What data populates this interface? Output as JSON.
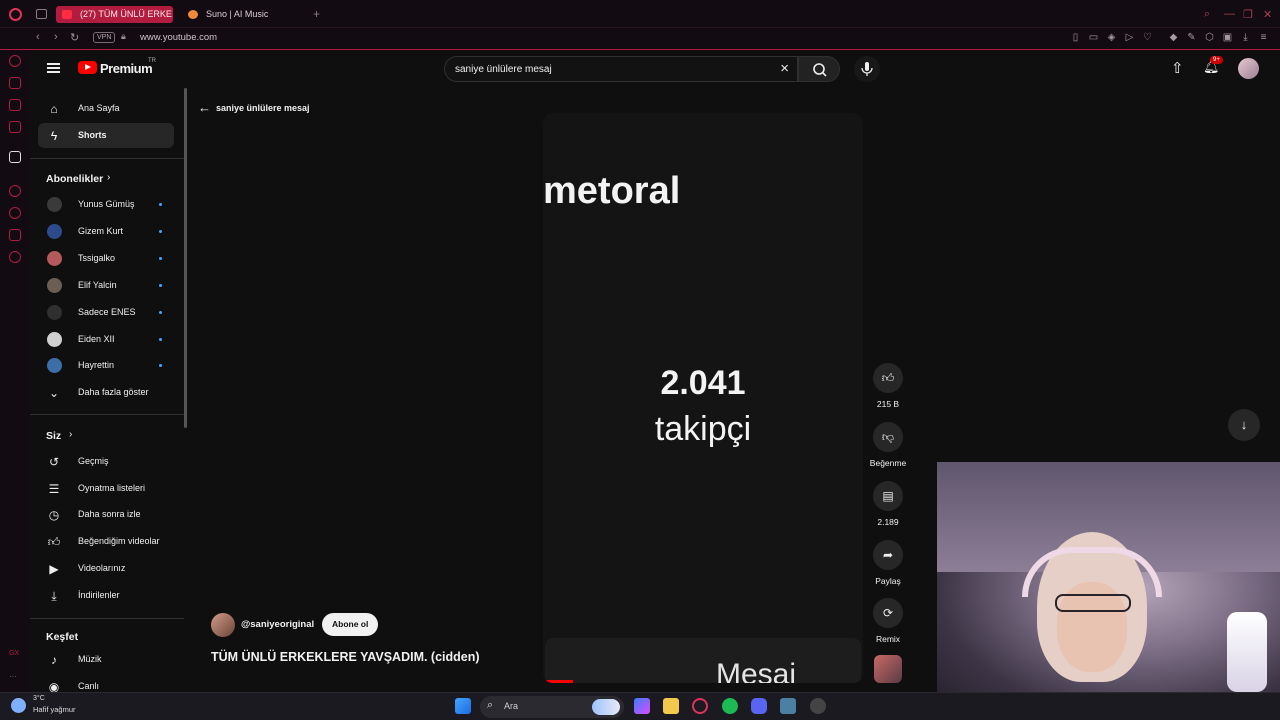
{
  "browser": {
    "tabs": [
      {
        "label": "(27) TÜM ÜNLÜ ERKE",
        "active": true
      },
      {
        "label": "Suno | AI Music",
        "active": false
      }
    ],
    "vpn_label": "VPN",
    "url": "www.youtube.com"
  },
  "header": {
    "brand": "Premium",
    "region": "TR",
    "search_value": "saniye ünlülere mesaj",
    "notification_count": "9+"
  },
  "sidebar": {
    "main": [
      {
        "label": "Ana Sayfa",
        "icon": "home-icon"
      },
      {
        "label": "Shorts",
        "icon": "shorts-icon",
        "active": true
      }
    ],
    "subscriptions_title": "Abonelikler",
    "subscriptions": [
      {
        "label": "Yunus Gümüş"
      },
      {
        "label": "Gizem Kurt"
      },
      {
        "label": "Tssigalko"
      },
      {
        "label": "Elif Yalcin"
      },
      {
        "label": "Sadece ENES"
      },
      {
        "label": "Eiden XII"
      },
      {
        "label": "Hayrettin"
      }
    ],
    "show_more": "Daha fazla göster",
    "you_title": "Siz",
    "you": [
      {
        "label": "Geçmiş",
        "icon": "history-icon"
      },
      {
        "label": "Oynatma listeleri",
        "icon": "playlist-icon"
      },
      {
        "label": "Daha sonra izle",
        "icon": "clock-icon"
      },
      {
        "label": "Beğendiğim videolar",
        "icon": "like-icon"
      },
      {
        "label": "Videolarınız",
        "icon": "video-icon"
      },
      {
        "label": "İndirilenler",
        "icon": "download-icon"
      }
    ],
    "explore_title": "Keşfet",
    "explore": [
      {
        "label": "Müzik",
        "icon": "music-icon"
      },
      {
        "label": "Canlı",
        "icon": "live-icon"
      }
    ]
  },
  "shorts": {
    "back_label": "saniye ünlülere mesaj",
    "video_text_top": "metoral",
    "video_count": "2.041",
    "video_count_label": "takipçi",
    "video_text_bottom": "Mesaj",
    "actions": {
      "like": "215 B",
      "dislike": "Beğenme",
      "comments": "2.189",
      "share": "Paylaş",
      "remix": "Remix"
    },
    "channel": "@saniyeoriginal",
    "subscribe": "Abone ol",
    "title": "TÜM ÜNLÜ ERKEKLERE YAVŞADIM. (cidden)"
  },
  "taskbar": {
    "temperature": "3°C",
    "weather": "Hafif yağmur",
    "search_placeholder": "Ara"
  },
  "colors": {
    "accent": "#b21c3f",
    "youtube_red": "#ff0000",
    "link_blue": "#3ea6ff"
  }
}
